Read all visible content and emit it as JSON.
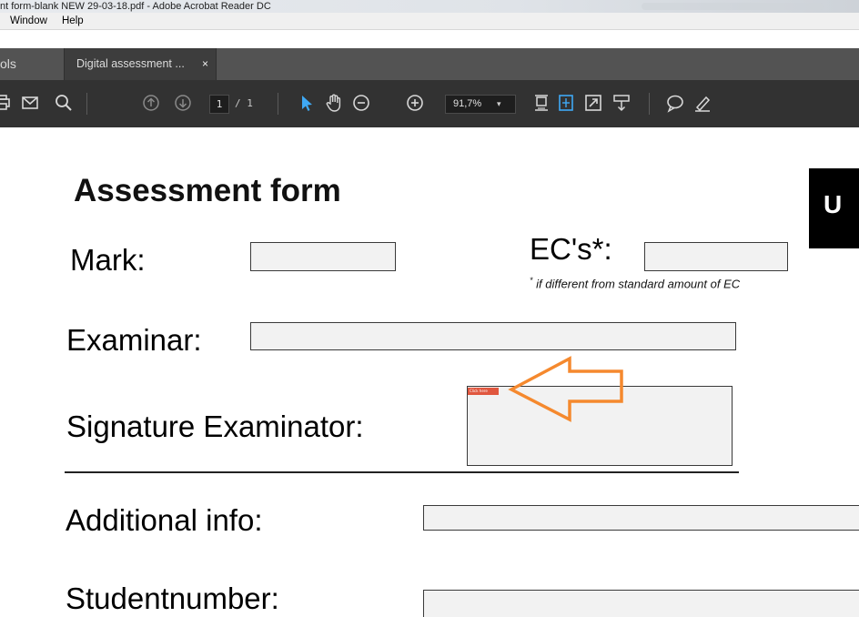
{
  "window": {
    "title": "nt form-blank NEW 29-03-18.pdf - Adobe Acrobat Reader DC"
  },
  "menu": {
    "items": [
      "Window",
      "Help"
    ]
  },
  "tabs": {
    "tools_label": "ols",
    "document_tab_label": "Digital assessment ...",
    "close_glyph": "×"
  },
  "toolbar": {
    "page_current": "1",
    "page_total": "/ 1",
    "zoom_value": "91,7%",
    "zoom_dropdown_glyph": "▾",
    "icons": [
      "print-icon",
      "email-icon",
      "search-icon",
      "page-up-icon",
      "page-down-icon",
      "select-arrow-icon",
      "hand-tool-icon",
      "zoom-out-icon",
      "zoom-in-icon",
      "fit-page-icon",
      "scrolling-mode-icon",
      "full-screen-icon",
      "read-mode-icon",
      "comment-icon",
      "highlight-pen-icon"
    ],
    "accent_color": "#3fa9f5"
  },
  "document": {
    "heading": "Assessment form",
    "logo_letter": "U",
    "fields": {
      "mark_label": "Mark:",
      "ecs_label": "EC's*:",
      "footnote_star": "*",
      "footnote_text": " if different from standard amount of EC",
      "examinar_label": "Examinar:",
      "signature_label": "Signature Examinator:",
      "signature_tab_text": "Click here",
      "additional_label": "Additional info:",
      "studentnumber_label": "Studentnumber:"
    },
    "annotation": {
      "arrow_color": "#f5892e",
      "signature_tab_color": "#e0573f"
    }
  }
}
